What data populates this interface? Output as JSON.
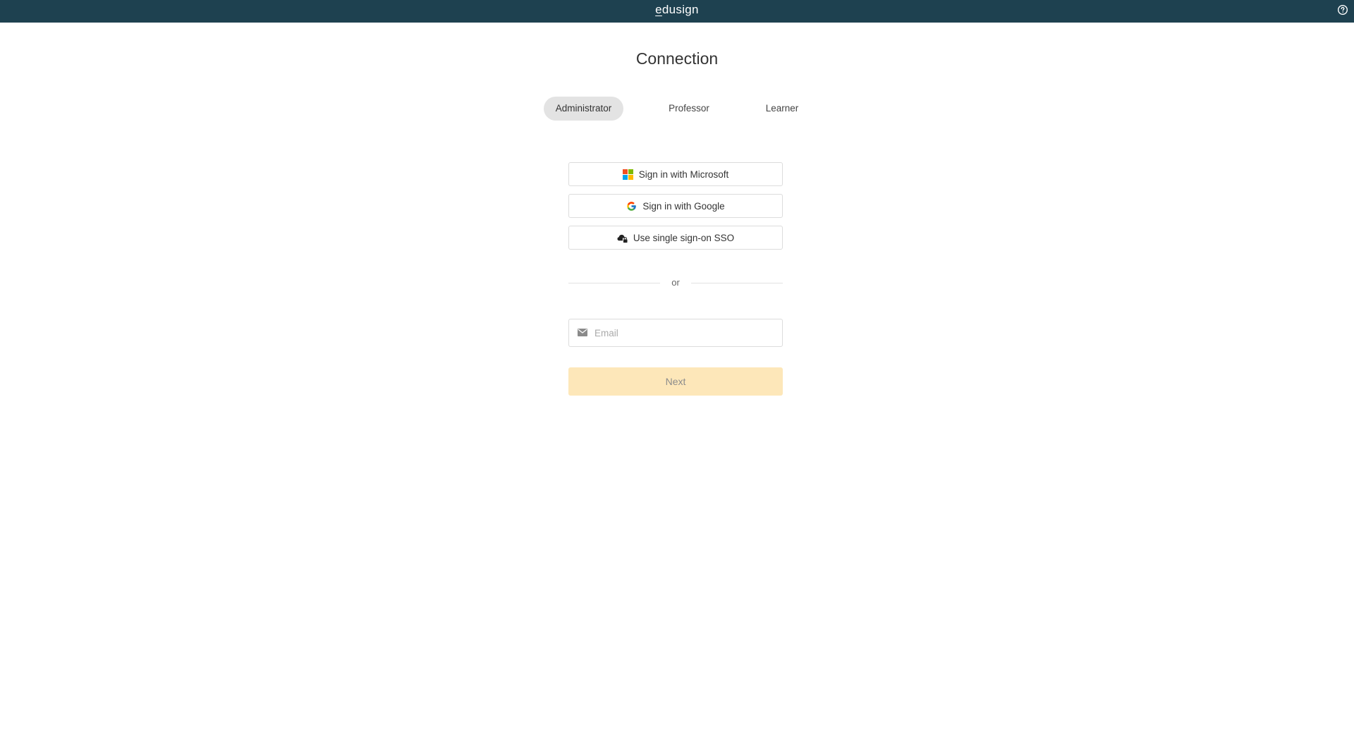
{
  "header": {
    "logo_first": "e",
    "logo_rest": "dusign",
    "help_icon": "question-circle-icon",
    "background": "#1e4150"
  },
  "page": {
    "title": "Connection"
  },
  "tabs": [
    {
      "label": "Administrator",
      "active": true
    },
    {
      "label": "Professor",
      "active": false
    },
    {
      "label": "Learner",
      "active": false
    }
  ],
  "sso": {
    "microsoft": {
      "label": "Sign in with Microsoft",
      "icon": "microsoft-icon"
    },
    "google": {
      "label": "Sign in with Google",
      "icon": "google-icon"
    },
    "single_sign_on": {
      "label": "Use single sign-on SSO",
      "icon": "cloud-lock-icon"
    }
  },
  "divider": {
    "label": "or"
  },
  "email": {
    "placeholder": "Email",
    "value": "",
    "icon": "envelope-icon"
  },
  "next_button": {
    "label": "Next",
    "background": "#fde7b9"
  }
}
